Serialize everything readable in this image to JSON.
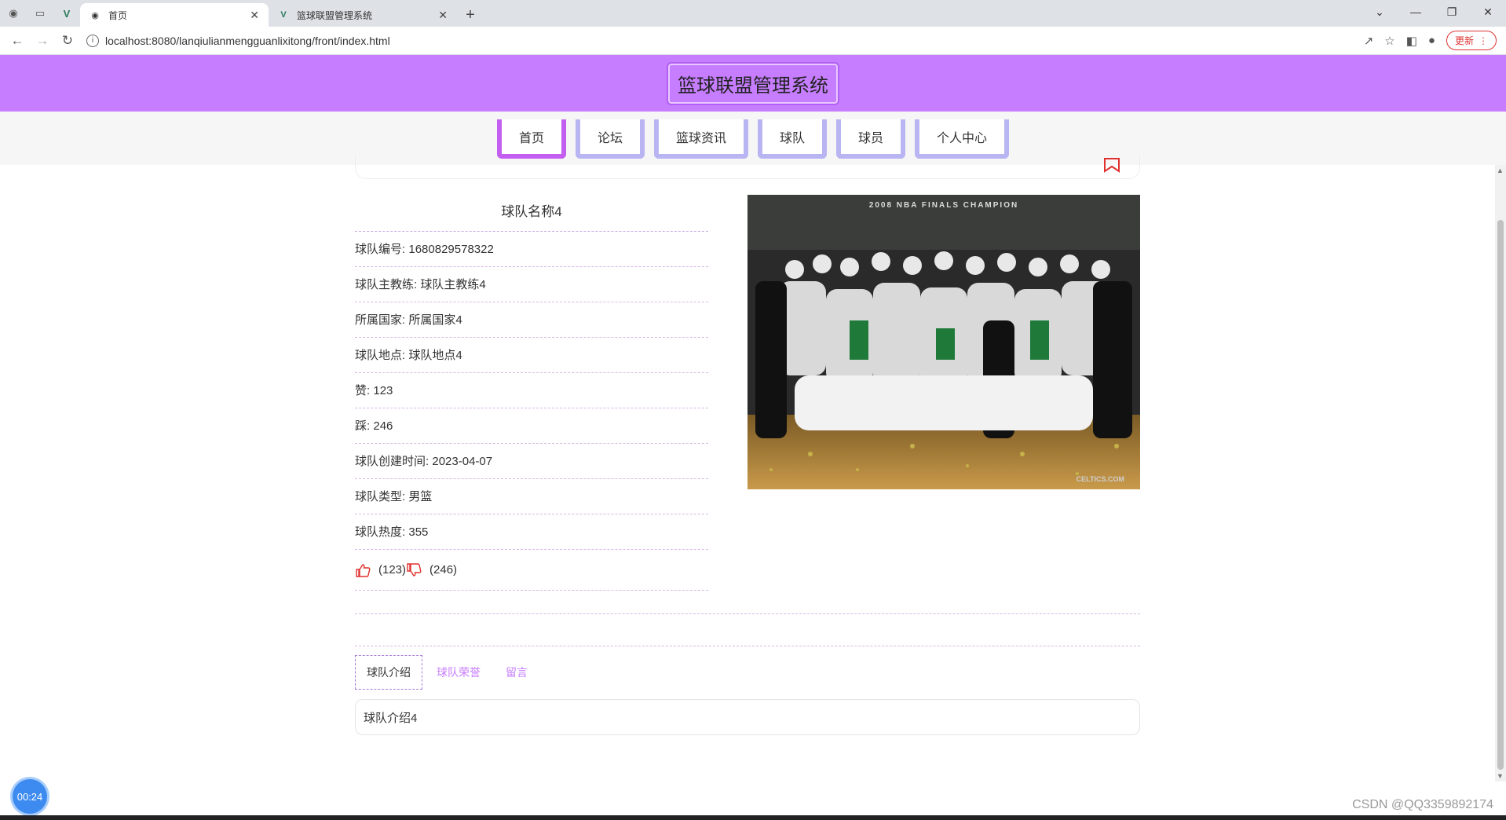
{
  "browser": {
    "tabs": [
      {
        "title": "首页",
        "active": true
      },
      {
        "title": "篮球联盟管理系统",
        "active": false
      }
    ],
    "url": "localhost:8080/lanqiulianmengguanlixitong/front/index.html",
    "update_label": "更新"
  },
  "site": {
    "title": "篮球联盟管理系统",
    "nav": [
      "首页",
      "论坛",
      "篮球资讯",
      "球队",
      "球员",
      "个人中心"
    ]
  },
  "team": {
    "name": "球队名称4",
    "fields": [
      {
        "label": "球队编号",
        "value": "1680829578322"
      },
      {
        "label": "球队主教练",
        "value": "球队主教练4"
      },
      {
        "label": "所属国家",
        "value": "所属国家4"
      },
      {
        "label": "球队地点",
        "value": "球队地点4"
      },
      {
        "label": "赞",
        "value": "123"
      },
      {
        "label": "踩",
        "value": "246"
      },
      {
        "label": "球队创建时间",
        "value": "2023-04-07"
      },
      {
        "label": "球队类型",
        "value": "男篮"
      },
      {
        "label": "球队热度",
        "value": "355"
      }
    ],
    "likes": "(123)",
    "dislikes": "(246)",
    "photo_text": {
      "banner": "2008 NBA FINALS CHAMPION",
      "credit": "CELTICS.COM"
    }
  },
  "content_tabs": [
    "球队介绍",
    "球队荣誉",
    "留言"
  ],
  "intro_text": "球队介绍4",
  "overlay": {
    "timer": "00:24",
    "watermark": "CSDN @QQ3359892174"
  }
}
